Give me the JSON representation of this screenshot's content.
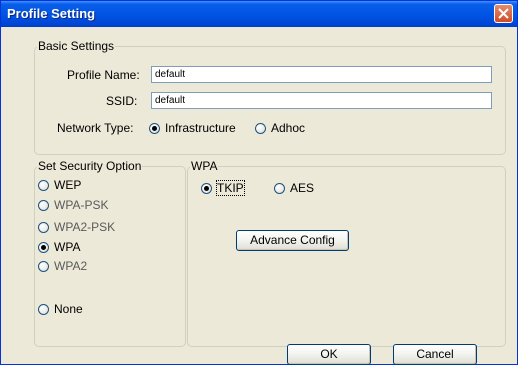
{
  "window": {
    "title": "Profile Setting"
  },
  "basic": {
    "legend": "Basic Settings",
    "profile_name_label": "Profile Name:",
    "profile_name_value": "default",
    "ssid_label": "SSID:",
    "ssid_value": "default",
    "network_type_label": "Network Type:",
    "network_types": [
      "Infrastructure",
      "Adhoc"
    ],
    "network_type_selected": "Infrastructure"
  },
  "security": {
    "legend": "Set Security Option",
    "options": [
      "WEP",
      "WPA-PSK",
      "WPA2-PSK",
      "WPA",
      "WPA2",
      "None"
    ],
    "selected": "WPA"
  },
  "wpa": {
    "legend": "WPA",
    "ciphers": [
      "TKIP",
      "AES"
    ],
    "cipher_selected": "TKIP",
    "advance_button": "Advance Config"
  },
  "buttons": {
    "ok": "OK",
    "cancel": "Cancel"
  }
}
